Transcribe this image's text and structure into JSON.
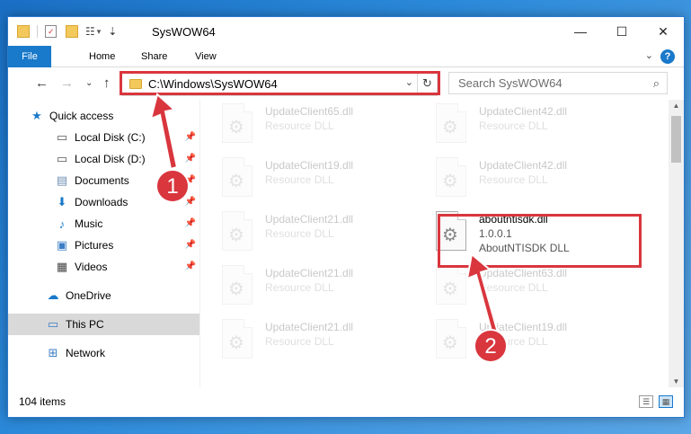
{
  "window": {
    "title": "SysWOW64",
    "controls": {
      "minimize": "—",
      "maximize": "☐",
      "close": "✕"
    }
  },
  "quick_access_toolbar": {
    "dropdown": "▾",
    "customize": "⇣"
  },
  "ribbon": {
    "tabs": [
      "File",
      "Home",
      "Share",
      "View"
    ],
    "help": "?",
    "expand": "⌄"
  },
  "address_bar": {
    "path": "C:\\Windows\\SysWOW64",
    "dropdown": "⌄",
    "refresh": "↻"
  },
  "search": {
    "placeholder": "Search SysWOW64"
  },
  "nav": {
    "back": "←",
    "forward": "→",
    "recent": "⌄",
    "up": "↑"
  },
  "sidebar": {
    "items": [
      {
        "label": "Quick access",
        "icon": "star-icon",
        "glyph": "★",
        "pinned": false
      },
      {
        "label": "Local Disk (C:)",
        "icon": "drive-icon",
        "glyph": "▭",
        "pinned": true
      },
      {
        "label": "Local Disk (D:)",
        "icon": "drive-icon",
        "glyph": "▭",
        "pinned": true
      },
      {
        "label": "Documents",
        "icon": "documents-icon",
        "glyph": "▤",
        "pinned": true
      },
      {
        "label": "Downloads",
        "icon": "download-icon",
        "glyph": "⬇",
        "pinned": true
      },
      {
        "label": "Music",
        "icon": "music-icon",
        "glyph": "♪",
        "pinned": true
      },
      {
        "label": "Pictures",
        "icon": "pictures-icon",
        "glyph": "▣",
        "pinned": true
      },
      {
        "label": "Videos",
        "icon": "videos-icon",
        "glyph": "▦",
        "pinned": true
      },
      {
        "label": "OneDrive",
        "icon": "cloud-icon",
        "glyph": "☁",
        "pinned": false
      },
      {
        "label": "This PC",
        "icon": "computer-icon",
        "glyph": "▭",
        "pinned": false
      },
      {
        "label": "Network",
        "icon": "network-icon",
        "glyph": "⊞",
        "pinned": false
      }
    ],
    "pin_glyph": "📌"
  },
  "files": [
    {
      "name": "UpdateClient65.dll",
      "type": "Resource DLL"
    },
    {
      "name": "UpdateClient42.dll",
      "type": "Resource DLL"
    },
    {
      "name": "UpdateClient19.dll",
      "type": "Resource DLL"
    },
    {
      "name": "UpdateClient42.dll",
      "type": "Resource DLL"
    },
    {
      "name": "UpdateClient21.dll",
      "type": "Resource DLL"
    },
    {
      "name": "UpdateClient21.dll",
      "type": "Resource DLL"
    },
    {
      "name": "UpdateClient63.dll",
      "type": "Resource DLL"
    },
    {
      "name": "UpdateClient21.dll",
      "type": "Resource DLL"
    },
    {
      "name": "UpdateClient19.dll",
      "type": "Resource DLL"
    }
  ],
  "target_file": {
    "name": "aboutntisdk.dll",
    "version": "1.0.0.1",
    "description": "AboutNTISDK DLL"
  },
  "status": {
    "item_count": "104 items"
  },
  "annotations": {
    "step1": "1",
    "step2": "2",
    "color": "#d9363e"
  },
  "colors": {
    "accent": "#1979ca",
    "highlight": "#d9363e"
  }
}
